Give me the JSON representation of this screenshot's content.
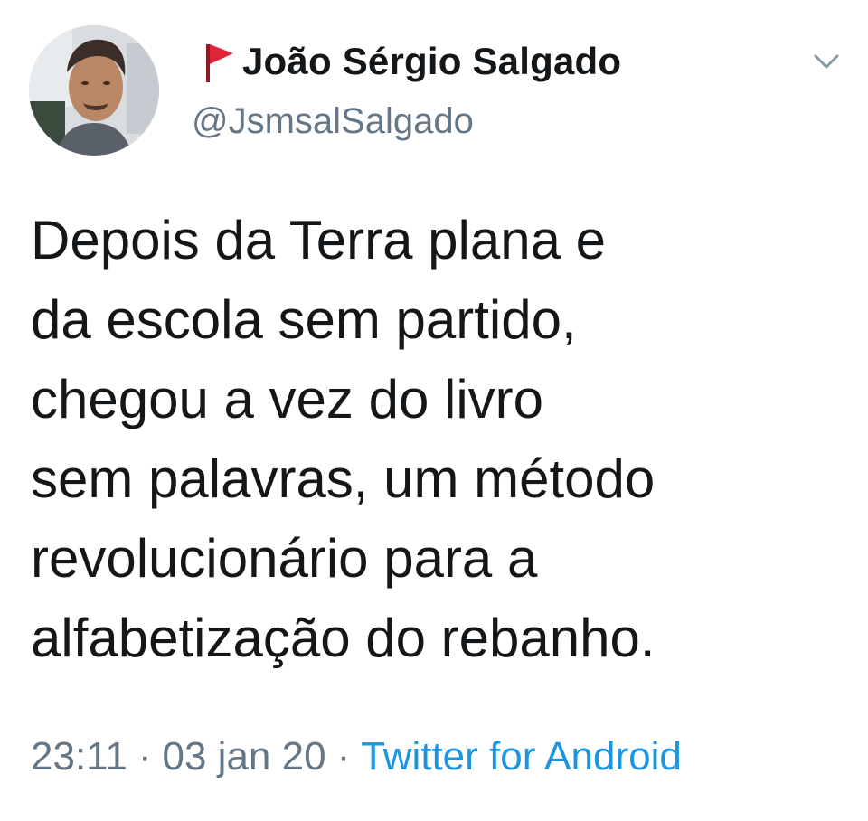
{
  "tweet": {
    "author": {
      "display_name": "João Sérgio Salgado",
      "handle": "@JsmsalSalgado",
      "flag_color": "#e0243a"
    },
    "text": "Depois da Terra plana e\nda escola sem partido,\nchegou a vez do livro\nsem palavras, um método\nrevolucionário para a\nalfabetização do rebanho.",
    "time": "23:11",
    "separator": "·",
    "date": "03 jan 20",
    "source": "Twitter for Android"
  },
  "colors": {
    "text_primary": "#14171a",
    "text_secondary": "#657786",
    "link": "#1b95e0"
  }
}
